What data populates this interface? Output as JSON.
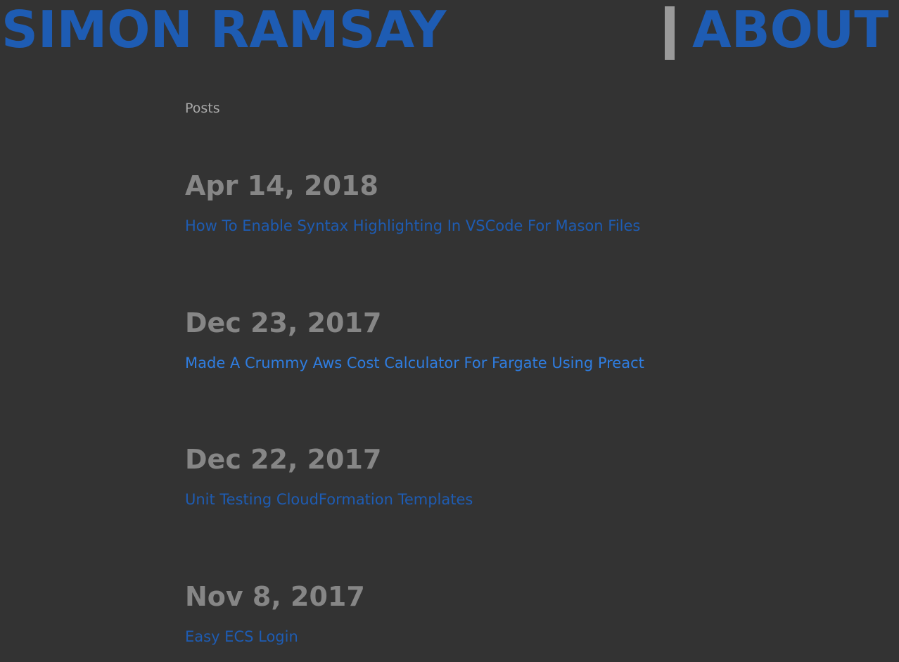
{
  "header": {
    "site_title": "SIMON RAMSAY",
    "nav_separator": "|",
    "nav_about": "ABOUT"
  },
  "main": {
    "section_label": "Posts",
    "posts": [
      {
        "date": "Apr 14, 2018",
        "title": "How To Enable Syntax Highlighting In VSCode For Mason Files"
      },
      {
        "date": "Dec 23, 2017",
        "title": "Made A Crummy Aws Cost Calculator For Fargate Using Preact"
      },
      {
        "date": "Dec 22, 2017",
        "title": "Unit Testing CloudFormation Templates"
      },
      {
        "date": "Nov 8, 2017",
        "title": "Easy ECS Login"
      }
    ]
  },
  "colors": {
    "background": "#333333",
    "link": "#1e5cb3",
    "link_hover": "#2f7de0",
    "date": "#868686",
    "muted": "#a9a9a9",
    "separator": "#9a9a9a"
  }
}
